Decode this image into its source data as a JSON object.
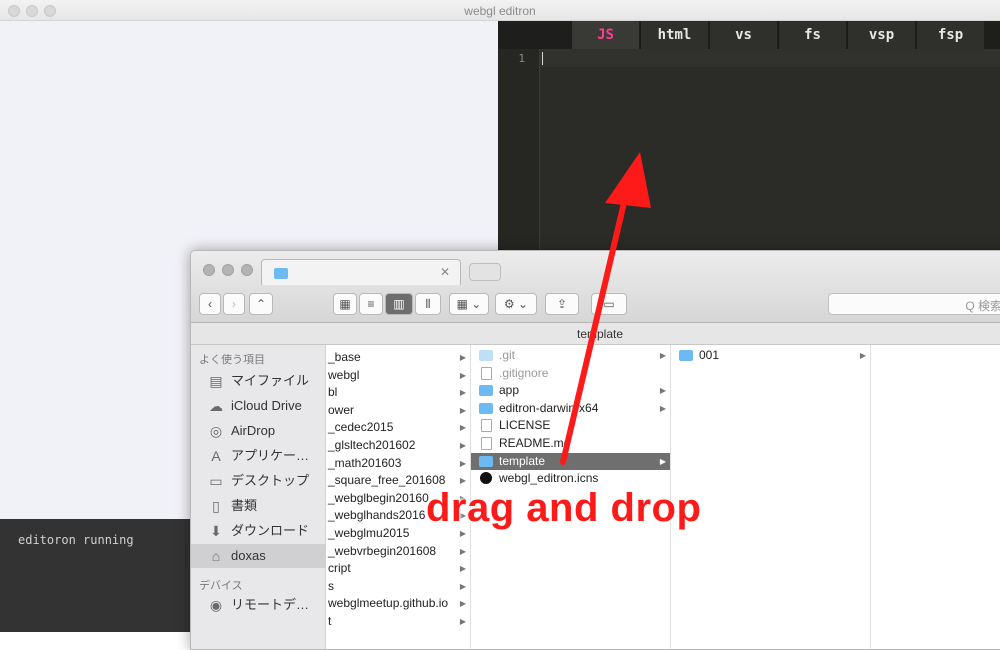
{
  "window": {
    "title": "webgl editron"
  },
  "editor": {
    "tabs": [
      {
        "label": "JS",
        "active": true
      },
      {
        "label": "html",
        "active": false
      },
      {
        "label": "vs",
        "active": false
      },
      {
        "label": "fs",
        "active": false
      },
      {
        "label": "vsp",
        "active": false
      },
      {
        "label": "fsp",
        "active": false
      }
    ],
    "line_number": "1",
    "accent_color": "#ff3b8d"
  },
  "console": {
    "text": "editoron running"
  },
  "finder": {
    "path_title": "template",
    "search_placeholder": "Q 検索",
    "sidebar": {
      "favorites_header": "よく使う項目",
      "devices_header": "デバイス",
      "items": [
        {
          "label": "マイファイル",
          "icon": "files-icon"
        },
        {
          "label": "iCloud Drive",
          "icon": "cloud-icon"
        },
        {
          "label": "AirDrop",
          "icon": "airdrop-icon"
        },
        {
          "label": "アプリケー…",
          "icon": "applications-icon"
        },
        {
          "label": "デスクトップ",
          "icon": "desktop-icon"
        },
        {
          "label": "書類",
          "icon": "documents-icon"
        },
        {
          "label": "ダウンロード",
          "icon": "downloads-icon"
        },
        {
          "label": "doxas",
          "icon": "home-icon",
          "selected": true
        }
      ],
      "devices": [
        {
          "label": "リモートデ…",
          "icon": "remote-disc-icon"
        }
      ]
    },
    "column1": [
      "_base",
      "webgl",
      "bl",
      "ower",
      "_cedec2015",
      "_glsltech201602",
      "_math201603",
      "_square_free_201608",
      "_webglbegin20160",
      "_webglhands2016",
      "_webglmu2015",
      "_webvrbegin201608",
      "cript",
      "s",
      "webglmeetup.github.io",
      "t"
    ],
    "column2": [
      {
        "name": ".git",
        "type": "folder-faded",
        "arrow": true
      },
      {
        "name": ".gitignore",
        "type": "doc-faded",
        "arrow": false
      },
      {
        "name": "app",
        "type": "folder",
        "arrow": true
      },
      {
        "name": "editron-darwin-x64",
        "type": "folder",
        "arrow": true
      },
      {
        "name": "LICENSE",
        "type": "doc",
        "arrow": false
      },
      {
        "name": "README.md",
        "type": "doc",
        "arrow": false
      },
      {
        "name": "template",
        "type": "folder",
        "arrow": true,
        "selected": true
      },
      {
        "name": "webgl_editron.icns",
        "type": "icns",
        "arrow": false
      }
    ],
    "column3": [
      {
        "name": "001",
        "type": "folder",
        "arrow": true
      }
    ]
  },
  "annotation": {
    "text": "drag and drop",
    "color": "#ff1a1a"
  }
}
